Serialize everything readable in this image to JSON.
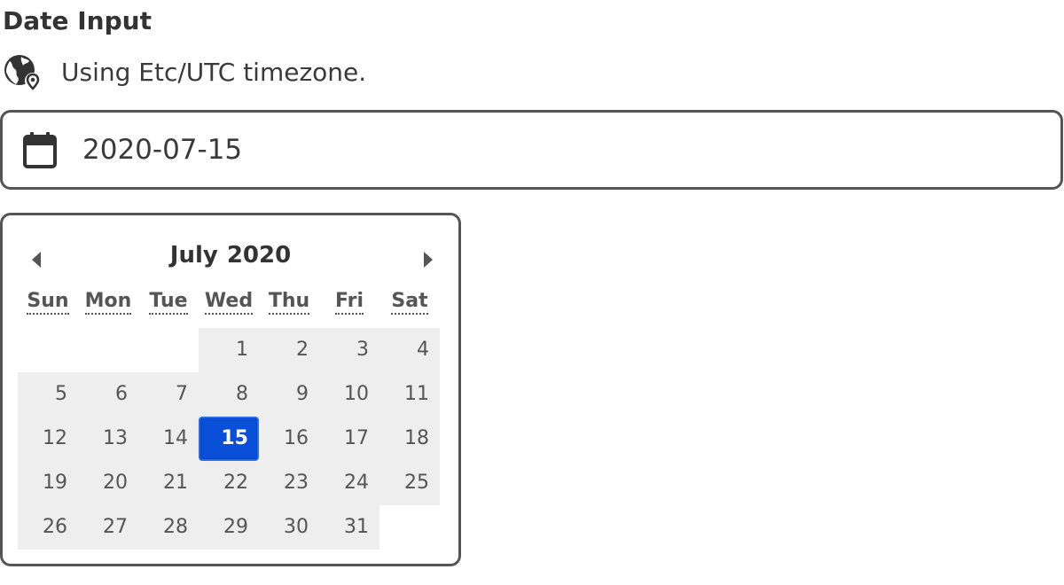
{
  "heading": "Date Input",
  "timezone": {
    "icon": "globe-pin-icon",
    "text": "Using Etc/UTC timezone."
  },
  "date_field": {
    "icon": "calendar-icon",
    "value": "2020-07-15"
  },
  "calendar": {
    "month": "July",
    "year": "2020",
    "prev_icon": "caret-left-icon",
    "next_icon": "caret-right-icon",
    "weekdays": [
      "Sun",
      "Mon",
      "Tue",
      "Wed",
      "Thu",
      "Fri",
      "Sat"
    ],
    "selected_day": "15",
    "weeks": [
      [
        "",
        "",
        "",
        "1",
        "2",
        "3",
        "4"
      ],
      [
        "5",
        "6",
        "7",
        "8",
        "9",
        "10",
        "11"
      ],
      [
        "12",
        "13",
        "14",
        "15",
        "16",
        "17",
        "18"
      ],
      [
        "19",
        "20",
        "21",
        "22",
        "23",
        "24",
        "25"
      ],
      [
        "26",
        "27",
        "28",
        "29",
        "30",
        "31",
        ""
      ]
    ]
  },
  "colors": {
    "selected": "#0a4fd8",
    "cell_background": "#eeeeee",
    "border": "#555555"
  }
}
